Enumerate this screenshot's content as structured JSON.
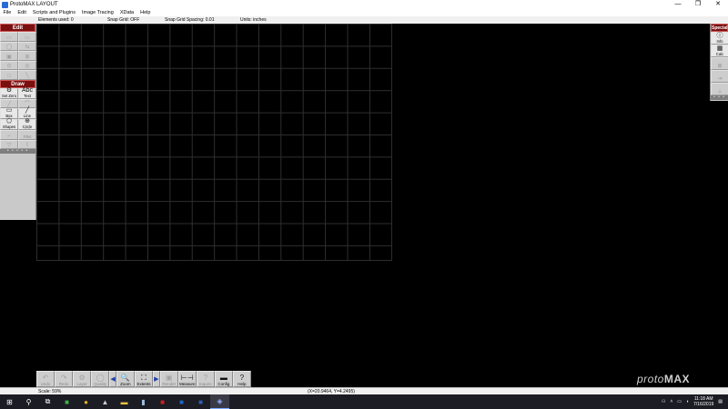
{
  "window": {
    "title": "ProtoMAX LAYOUT",
    "minimize": "—",
    "restore": "❐",
    "close": "✕"
  },
  "menu": [
    "File",
    "Edit",
    "Scripts and Plugins",
    "Image Tracing",
    "XData",
    "Help"
  ],
  "info": {
    "elements": "Elements used: 0",
    "snap_grid": "Snap Grid: OFF",
    "snap_spacing": "Snap Grid Spacing: 0.01",
    "units": "Units: inches"
  },
  "left_tools": {
    "edit_header": "Edit",
    "edit_tools": [
      {
        "glyph": "▭",
        "label": ""
      },
      {
        "glyph": "▭",
        "label": ""
      },
      {
        "glyph": "◯",
        "label": ""
      },
      {
        "glyph": "⇆",
        "label": ""
      },
      {
        "glyph": "▣",
        "label": ""
      },
      {
        "glyph": "⊞",
        "label": ""
      },
      {
        "glyph": "⊙",
        "label": ""
      },
      {
        "glyph": "◎",
        "label": ""
      },
      {
        "glyph": "□",
        "label": ""
      },
      {
        "glyph": "╲",
        "label": ""
      }
    ],
    "draw_header": "Draw",
    "draw_active": [
      {
        "glyph": "⚙",
        "label": "Set Zero"
      },
      {
        "glyph": "Abc",
        "label": "Text"
      }
    ],
    "draw_dim_1": [
      {
        "glyph": "╱",
        "label": ""
      },
      {
        "glyph": "⌒",
        "label": ""
      }
    ],
    "draw_active_2": [
      {
        "glyph": "▭",
        "label": "Box"
      },
      {
        "glyph": "╱",
        "label": "Line"
      },
      {
        "glyph": "⬠",
        "label": "Shapes"
      },
      {
        "glyph": "⊕",
        "label": "Circle"
      }
    ],
    "draw_dim_2": [
      {
        "glyph": "⌐",
        "label": ""
      },
      {
        "glyph": "⌒",
        "label": "Fillet"
      },
      {
        "glyph": "▽",
        "label": ""
      },
      {
        "glyph": "⌇",
        "label": ""
      }
    ],
    "more": "• • • • •"
  },
  "right_tools": {
    "header": "Special",
    "tools": [
      {
        "glyph": "ⓘ",
        "label": "Info"
      },
      {
        "glyph": "▦",
        "label": "Calc"
      },
      {
        "glyph": "⊠",
        "label": ""
      },
      {
        "glyph": "⇥",
        "label": ""
      },
      {
        "glyph": "⟂",
        "label": ""
      }
    ],
    "more": "• • •"
  },
  "bottom_tools": [
    {
      "glyph": "↶",
      "label": "Undo",
      "on": false
    },
    {
      "glyph": "↷",
      "label": "Redo",
      "on": false
    },
    {
      "glyph": "⚙",
      "label": "Layer",
      "on": false
    },
    {
      "glyph": "◯",
      "label": "Quality",
      "on": false
    },
    {
      "glyph": "◀",
      "label": "",
      "arrow": true
    },
    {
      "glyph": "🔍",
      "label": "Zoom",
      "on": true
    },
    {
      "glyph": "⛶",
      "label": "Extents",
      "on": true
    },
    {
      "glyph": "▶",
      "label": "",
      "arrow": true
    },
    {
      "glyph": "▣",
      "label": "Render",
      "on": false
    },
    {
      "glyph": "⊢⊣",
      "label": "Measure",
      "on": true
    },
    {
      "glyph": "?",
      "label": "Inquire",
      "on": false
    },
    {
      "glyph": "▬",
      "label": "Config",
      "on": true
    },
    {
      "glyph": "?",
      "label": "Help",
      "on": true
    }
  ],
  "logo": {
    "light": "proto",
    "bold": "MAX"
  },
  "status": {
    "scale": "Scale: 59%",
    "coords": "(X=20.9464, Y=4.2495)"
  },
  "taskbar": {
    "apps": [
      {
        "name": "start-icon",
        "glyph": "⊞",
        "color": "#ffffff"
      },
      {
        "name": "search-icon",
        "glyph": "⚲",
        "color": "#ffffff"
      },
      {
        "name": "task-view-icon",
        "glyph": "⧉",
        "color": "#ffffff"
      },
      {
        "name": "green-app-icon",
        "glyph": "■",
        "color": "#3fae49"
      },
      {
        "name": "chrome-icon",
        "glyph": "●",
        "color": "#e0b020"
      },
      {
        "name": "app-icon-up",
        "glyph": "▲",
        "color": "#cccccc"
      },
      {
        "name": "file-explorer-icon",
        "glyph": "▬",
        "color": "#f0c040"
      },
      {
        "name": "terminal-icon",
        "glyph": "▮",
        "color": "#9fbfe0"
      },
      {
        "name": "acrobat-icon",
        "glyph": "■",
        "color": "#d02020"
      },
      {
        "name": "outlook-icon",
        "glyph": "■",
        "color": "#1e66c8"
      },
      {
        "name": "word-icon",
        "glyph": "■",
        "color": "#2b5fb3"
      },
      {
        "name": "protomax-icon",
        "glyph": "◈",
        "color": "#8fb0ff",
        "active": true
      }
    ],
    "time": "11:18 AM",
    "date": "7/16/2019"
  }
}
